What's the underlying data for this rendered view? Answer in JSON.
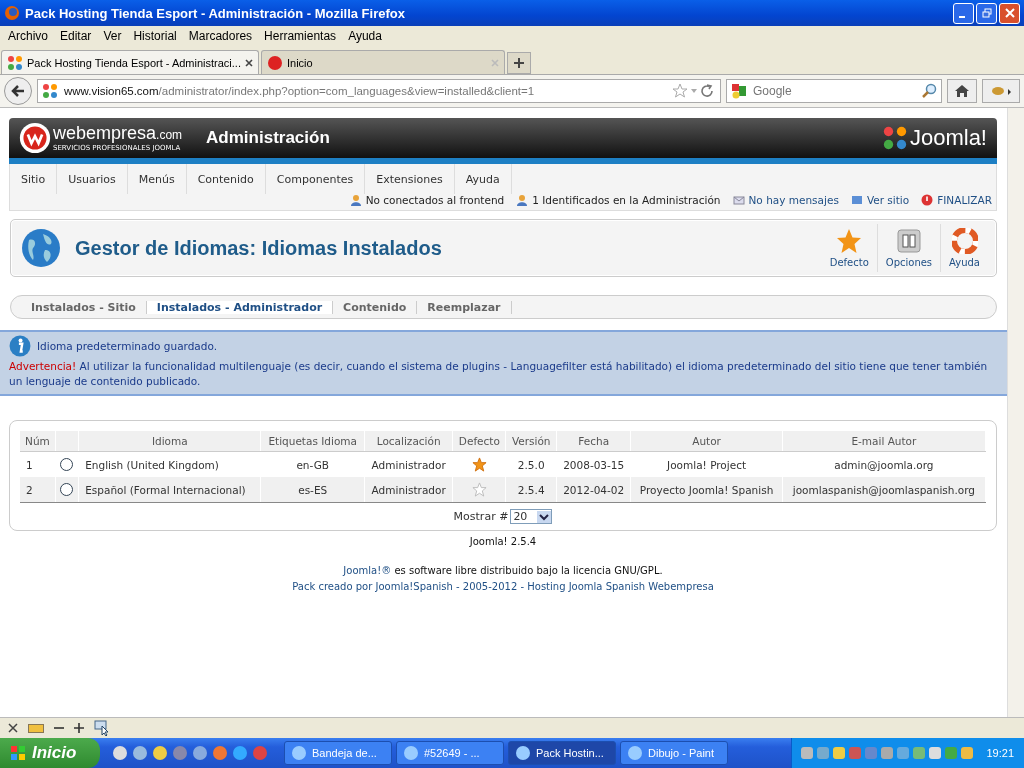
{
  "window": {
    "title": "Pack Hosting Tienda Esport - Administración - Mozilla Firefox"
  },
  "menu_bar": [
    "Archivo",
    "Editar",
    "Ver",
    "Historial",
    "Marcadores",
    "Herramientas",
    "Ayuda"
  ],
  "browser_tabs": [
    {
      "title": "Pack Hosting Tienda Esport - Administraci...",
      "selected": true,
      "kind": "joomla"
    },
    {
      "title": "Inicio",
      "selected": false,
      "kind": "webempresa"
    }
  ],
  "address_bar": {
    "url_host": "www.vision65.com",
    "url_path": "/administrator/index.php?option=com_languages&view=installed&client=1"
  },
  "search": {
    "placeholder": "Google"
  },
  "admin_header": {
    "brand": "webempresa",
    "brand_suffix": ".com",
    "brand_tagline": "SERVICIOS PROFESIONALES JOOMLA",
    "title": "Administración",
    "logo": "Joomla!"
  },
  "main_menu": [
    "Sitio",
    "Usuarios",
    "Menús",
    "Contenido",
    "Componentes",
    "Extensiones",
    "Ayuda"
  ],
  "status_links": [
    {
      "label": "No conectados al frontend",
      "kind": "users"
    },
    {
      "label": "1 Identificados en la Administración",
      "kind": "users"
    },
    {
      "label": "No hay mensajes",
      "kind": "mail"
    },
    {
      "label": "Ver sitio",
      "kind": "site"
    },
    {
      "label": "FINALIZAR",
      "kind": "logout"
    }
  ],
  "page_title": "Gestor de Idiomas: Idiomas Instalados",
  "toolbar": [
    {
      "label": "Defecto",
      "kind": "star"
    },
    {
      "label": "Opciones",
      "kind": "options"
    },
    {
      "label": "Ayuda",
      "kind": "help"
    }
  ],
  "subtabs": [
    {
      "label": "Instalados - Sitio",
      "selected": false
    },
    {
      "label": "Instalados - Administrador",
      "selected": true
    },
    {
      "label": "Contenido",
      "selected": false
    },
    {
      "label": "Reemplazar",
      "selected": false
    }
  ],
  "message": {
    "info": "Idioma predeterminado guardado.",
    "warning_label": "Advertencia!",
    "warning": " Al utilizar la funcionalidad multilenguaje (es decir, cuando el sistema de plugins - Languagefilter está habilitado) el idioma predeterminado del sitio tiene que tener también un lenguaje de contenido publicado."
  },
  "table": {
    "columns": [
      "Núm",
      "Idioma",
      "Etiquetas Idioma",
      "Localización",
      "Defecto",
      "Versión",
      "Fecha",
      "Autor",
      "E-mail Autor"
    ],
    "rows": [
      {
        "selected": false,
        "num": "1",
        "language": "English (United Kingdom)",
        "tag": "en-GB",
        "location": "Administrador",
        "default": true,
        "version": "2.5.0",
        "date": "2008-03-15",
        "author": "Joomla! Project",
        "email": "admin@joomla.org"
      },
      {
        "selected": false,
        "num": "2",
        "language": "Español (Formal Internacional)",
        "tag": "es-ES",
        "location": "Administrador",
        "default": false,
        "version": "2.5.4",
        "date": "2012-04-02",
        "author": "Proyecto Joomla! Spanish",
        "email": "joomlaspanish@joomlaspanish.org"
      }
    ],
    "limit_label": "Mostrar #",
    "limit_value": "20"
  },
  "footer": {
    "version": "Joomla! 2.5.4",
    "license_link": "Joomla!®",
    "license": " es software libre distribuido bajo la licencia GNU/GPL.",
    "credits": "Pack creado por Joomla!Spanish - 2005-2012 - Hosting Joomla Spanish Webempresa"
  },
  "taskbar": {
    "start": "Inicio",
    "tasks": [
      {
        "label": "Bandeja de...",
        "selected": false
      },
      {
        "label": "#52649 - ...",
        "selected": false
      },
      {
        "label": "Pack Hostin...",
        "selected": true
      },
      {
        "label": "Dibujo - Paint",
        "selected": false
      }
    ],
    "clock": "19:21"
  }
}
